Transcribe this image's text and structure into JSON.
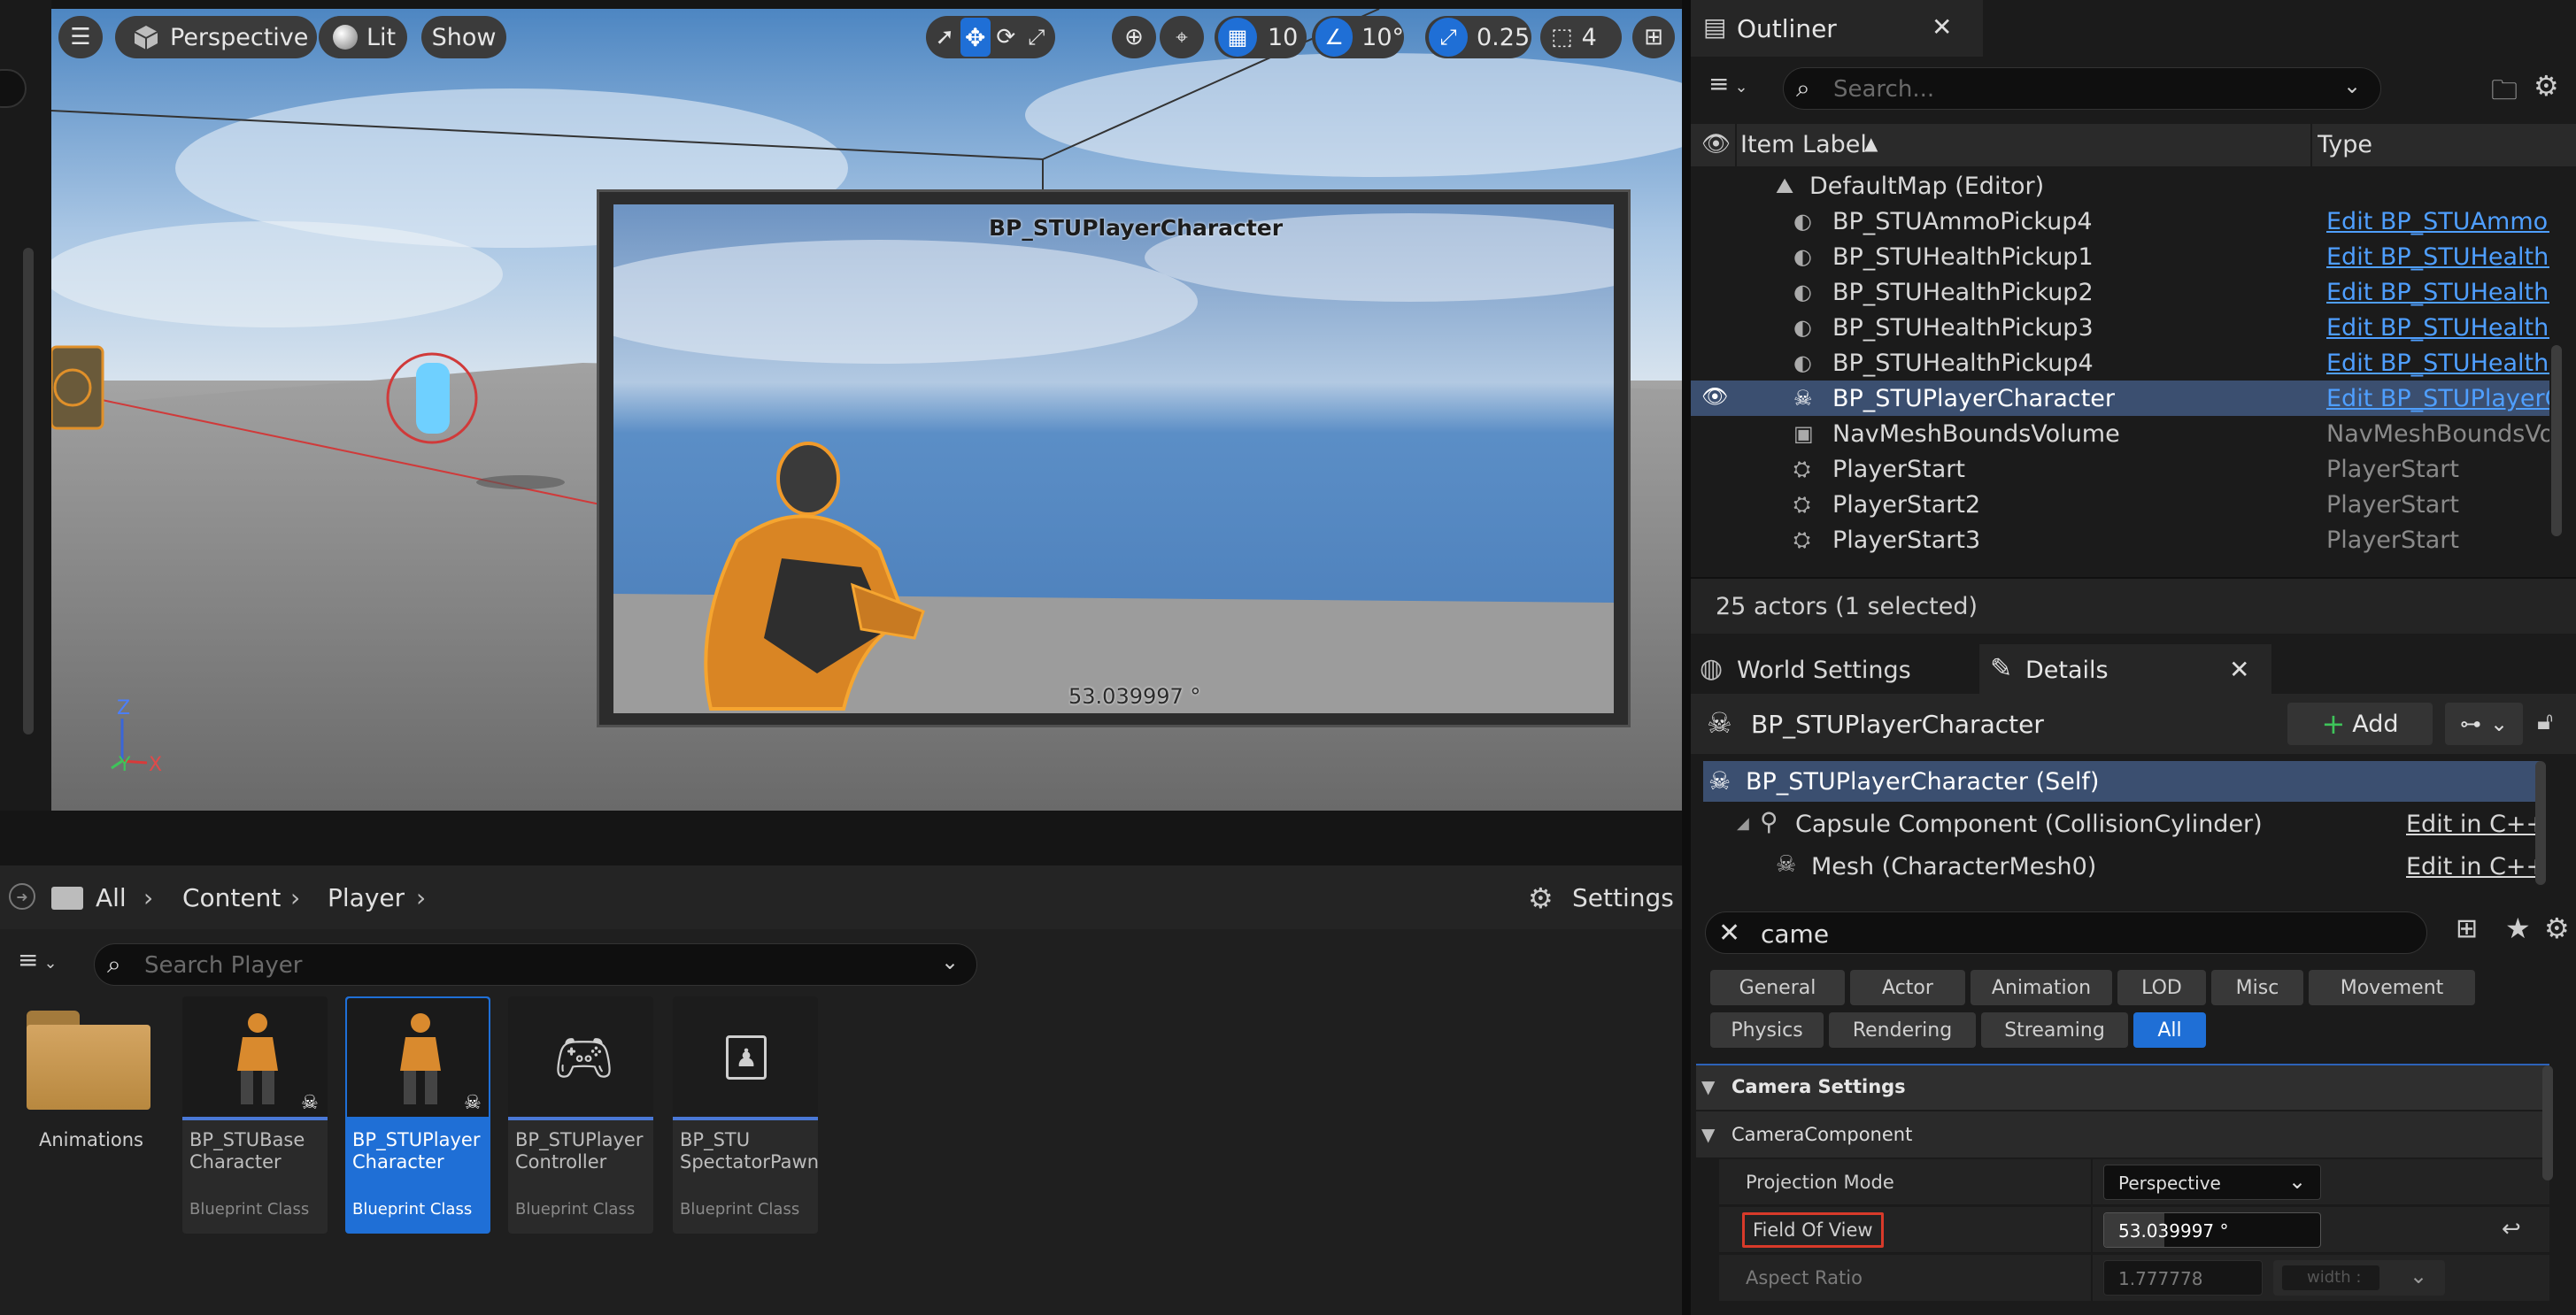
{
  "viewport": {
    "perspective_label": "Perspective",
    "lit_label": "Lit",
    "show_label": "Show",
    "grid_value": "10",
    "angle_value": "10°",
    "scale_value": "0.25",
    "camera_speed": "4",
    "actor_label": "BP_STUPlayerCharacter",
    "preview_fov": "53.039997 °",
    "axis": {
      "z": "Z",
      "y": "Y",
      "x": "X"
    }
  },
  "outliner": {
    "tab_label": "Outliner",
    "search_placeholder": "Search...",
    "col_label": "Item Label",
    "col_type": "Type",
    "root_item": "DefaultMap (Editor)",
    "rows": [
      {
        "label": "BP_STUAmmoPickup4",
        "type": "Edit BP_STUAmmoF",
        "link": true
      },
      {
        "label": "BP_STUHealthPickup1",
        "type": "Edit BP_STUHealthF",
        "link": true
      },
      {
        "label": "BP_STUHealthPickup2",
        "type": "Edit BP_STUHealthF",
        "link": true
      },
      {
        "label": "BP_STUHealthPickup3",
        "type": "Edit BP_STUHealthF",
        "link": true
      },
      {
        "label": "BP_STUHealthPickup4",
        "type": "Edit BP_STUHealthF",
        "link": true
      },
      {
        "label": "BP_STUPlayerCharacter",
        "type": "Edit BP_STUPlayerC",
        "link": true
      },
      {
        "label": "NavMeshBoundsVolume",
        "type": "NavMeshBoundsVol",
        "link": false
      },
      {
        "label": "PlayerStart",
        "type": "PlayerStart",
        "link": false
      },
      {
        "label": "PlayerStart2",
        "type": "PlayerStart",
        "link": false
      },
      {
        "label": "PlayerStart3",
        "type": "PlayerStart",
        "link": false
      }
    ],
    "footer": "25 actors (1 selected)"
  },
  "details": {
    "world_settings_tab": "World Settings",
    "details_tab": "Details",
    "actor_name": "BP_STUPlayerCharacter",
    "add_label": "Add",
    "components": [
      {
        "label": "BP_STUPlayerCharacter (Self)",
        "edit": ""
      },
      {
        "label": "Capsule Component (CollisionCylinder)",
        "edit": "Edit in C++"
      },
      {
        "label": "Mesh (CharacterMesh0)",
        "edit": "Edit in C++"
      }
    ],
    "search_value": "came",
    "filters_row1": [
      "General",
      "Actor",
      "Animation",
      "LOD",
      "Misc",
      "Movement"
    ],
    "filters_row2": [
      "Physics",
      "Rendering",
      "Streaming",
      "All"
    ],
    "section_camera_settings": "Camera Settings",
    "section_camera_component": "CameraComponent",
    "props": {
      "projection_mode_label": "Projection Mode",
      "projection_mode_value": "Perspective",
      "fov_label": "Field Of View",
      "fov_value": "53.039997 °",
      "aspect_label": "Aspect Ratio",
      "aspect_value": "1.777778",
      "aspect_unit": "width :"
    }
  },
  "content_browser": {
    "breadcrumb": [
      "All",
      "Content",
      "Player"
    ],
    "settings_label": "Settings",
    "search_placeholder": "Search Player",
    "assets": [
      {
        "name": "Animations",
        "type": "",
        "kind": "folder"
      },
      {
        "name": "BP_STUBase\nCharacter",
        "type": "Blueprint Class",
        "kind": "character"
      },
      {
        "name": "BP_STUPlayer\nCharacter",
        "type": "Blueprint Class",
        "kind": "character"
      },
      {
        "name": "BP_STUPlayer\nController",
        "type": "Blueprint Class",
        "kind": "controller"
      },
      {
        "name": "BP_STU\nSpectatorPawn",
        "type": "Blueprint Class",
        "kind": "pawn"
      }
    ]
  },
  "colors": {
    "accent": "#1f6fd6",
    "selection": "#3b4f70",
    "highlight_box": "#d83a2a"
  }
}
